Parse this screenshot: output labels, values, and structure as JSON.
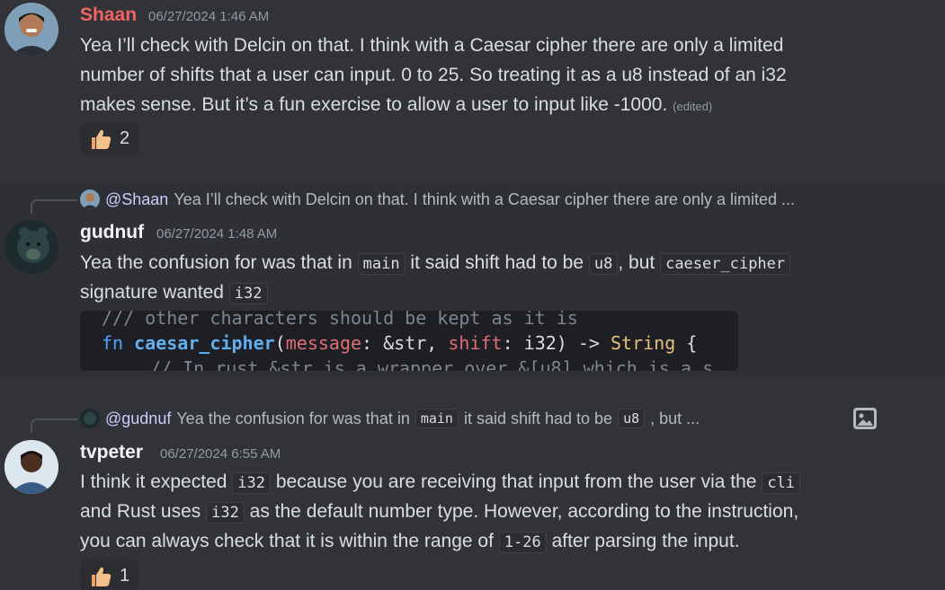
{
  "messages": [
    {
      "author": "Shaan",
      "timestamp": "06/27/2024 1:46 AM",
      "lines": [
        "Yea I’ll check with Delcin on that. I think with a Caesar cipher there are only a limited",
        "number of shifts that a user can input. 0 to 25. So treating it as a u8 instead of an i32",
        "makes sense. But it’s a fun exercise to allow a user to input like -1000."
      ],
      "edited_label": "(edited)",
      "reaction": {
        "emoji": "thumbs-up",
        "count": "2"
      },
      "name_color": "#f26461"
    },
    {
      "reply": {
        "mention": "@Shaan",
        "text": "Yea I’ll check with Delcin on that. I think with a Caesar cipher there are only a limited ..."
      },
      "author": "gudnuf",
      "timestamp": "06/27/2024 1:48 AM",
      "line1": {
        "a": "Yea the confusion for was that in",
        "c1": "main",
        "b": "it said shift had to be",
        "c2": "u8",
        "c": ", but",
        "c3": "caeser_cipher"
      },
      "line2": {
        "a": "signature wanted",
        "c1": "i32"
      },
      "code_image": {
        "line1": "/// other characters should be kept as it is",
        "line2": {
          "kw": "fn",
          "fn": "caesar_cipher",
          "p1": "(",
          "arg1": "message",
          "t1": ": &str, ",
          "arg2": "shift",
          "t2": ": i32) -> ",
          "ret": "String",
          "end": " {"
        },
        "line3": "// In rust &str is a wrapper over &[u8] which is a s"
      }
    },
    {
      "reply": {
        "mention": "@gudnuf",
        "a": "Yea the confusion for was that in",
        "c1": "main",
        "b": "it said shift had to be",
        "c2": "u8",
        "c": ", but ..."
      },
      "author": "tvpeter",
      "timestamp": "06/27/2024 6:55 AM",
      "line1": {
        "a": "I think it expected",
        "c1": "i32",
        "b": "because you are receiving that input from the user via the",
        "c2": "cli"
      },
      "line2": {
        "a": "and Rust uses",
        "c1": "i32",
        "b": "as the default number type. However, according to the instruction,"
      },
      "line3": {
        "a": "you can always check that it is within the range of",
        "c1": "1-26",
        "b": "after parsing the input."
      },
      "reaction": {
        "emoji": "thumbs-up",
        "count": "1"
      }
    }
  ]
}
